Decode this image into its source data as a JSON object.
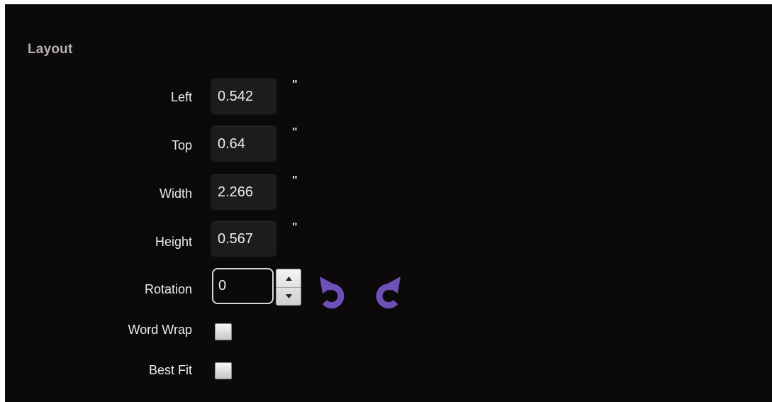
{
  "section": {
    "title": "Layout"
  },
  "fields": [
    {
      "label": "Left",
      "value": "0.542",
      "unit": "\""
    },
    {
      "label": "Top",
      "value": "0.64",
      "unit": "\""
    },
    {
      "label": "Width",
      "value": "2.266",
      "unit": "\""
    },
    {
      "label": "Height",
      "value": "0.567",
      "unit": "\""
    }
  ],
  "rotation": {
    "label": "Rotation",
    "value": "0",
    "rotate_left_icon": "rotate-counterclockwise-icon",
    "rotate_right_icon": "rotate-clockwise-icon",
    "icon_color": "#6f4fb8"
  },
  "options": [
    {
      "label": "Word Wrap",
      "checked": false
    },
    {
      "label": "Best Fit",
      "checked": false
    }
  ]
}
